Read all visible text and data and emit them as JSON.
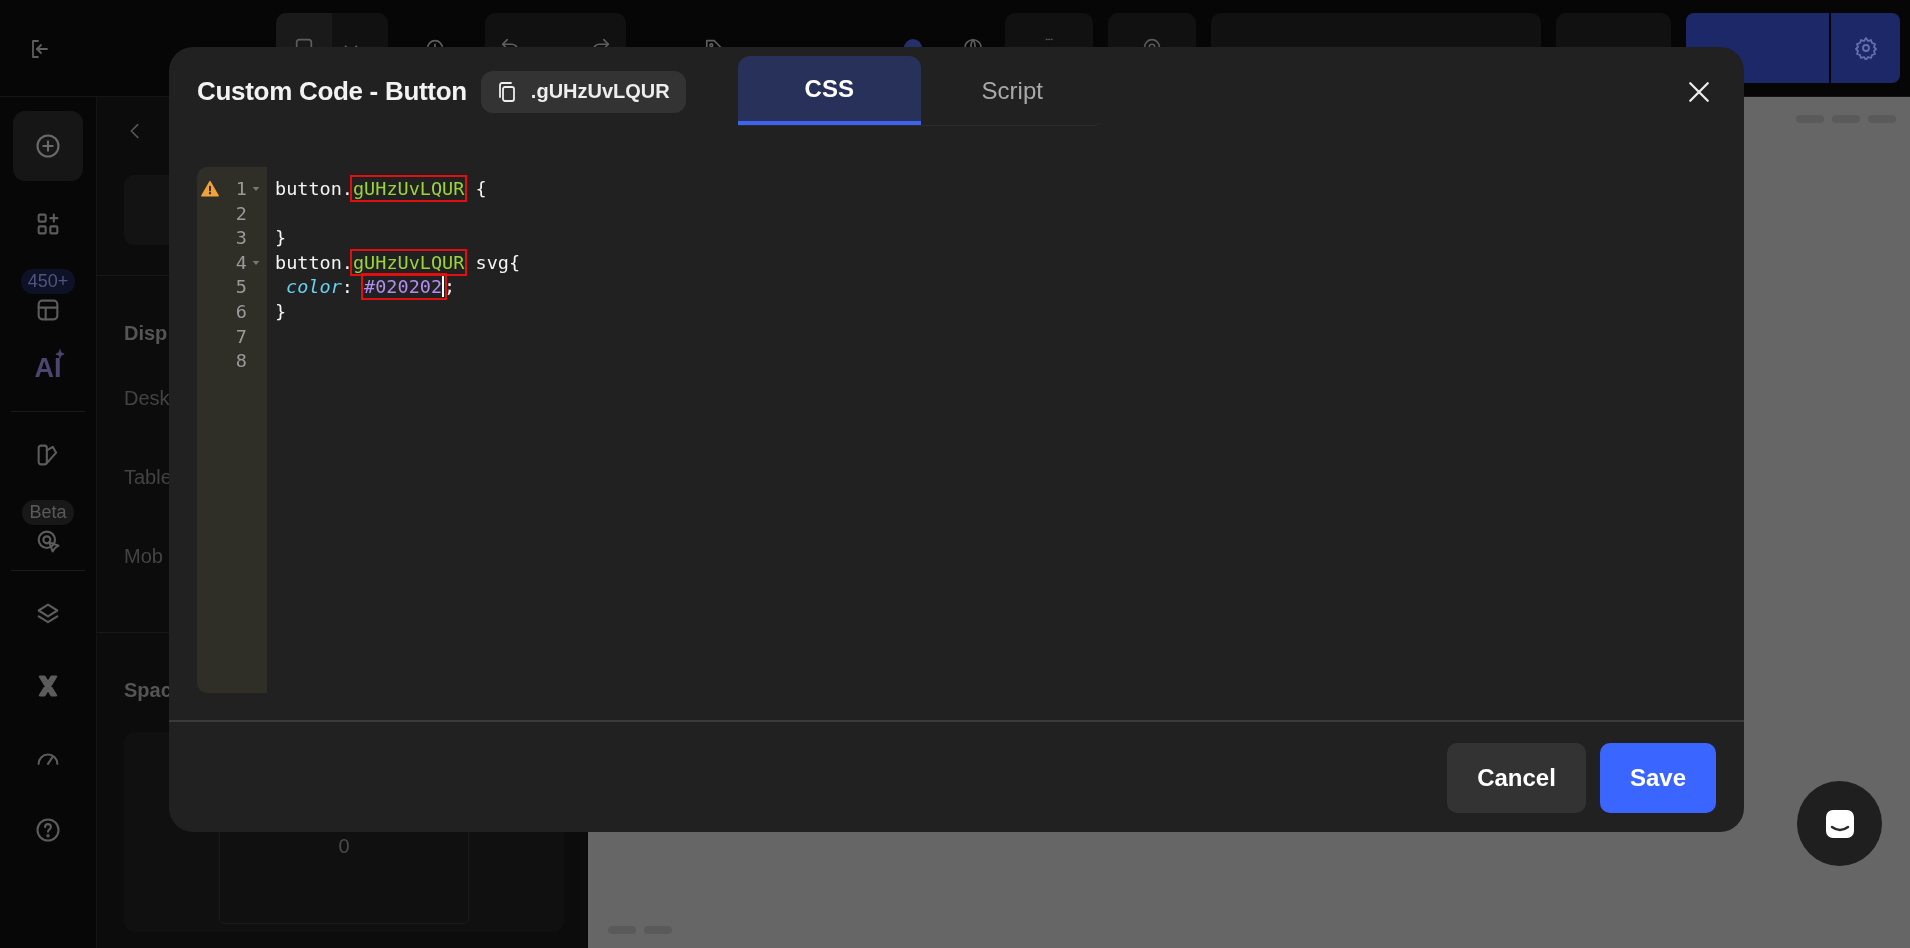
{
  "topbar": {
    "publish_highlighted": true
  },
  "rail": [
    {
      "kind": "add",
      "selected": true
    },
    {
      "kind": "elements"
    },
    {
      "kind": "templates",
      "badge": "450+"
    },
    {
      "kind": "ai",
      "label": "AI"
    },
    {
      "kind": "divider"
    },
    {
      "kind": "styles"
    },
    {
      "kind": "cursor",
      "badge": "Beta"
    },
    {
      "kind": "divider"
    },
    {
      "kind": "layers"
    },
    {
      "kind": "xmark"
    },
    {
      "kind": "speed"
    },
    {
      "kind": "help"
    }
  ],
  "panel": {
    "labels": [
      {
        "kind": "heading",
        "text": "Disp"
      },
      {
        "kind": "label",
        "text": "Desk"
      },
      {
        "kind": "label",
        "text": "Table"
      },
      {
        "kind": "label",
        "text": "Mob"
      },
      {
        "kind": "heading",
        "text": "Spac"
      }
    ],
    "spacing_value": "0"
  },
  "modal": {
    "title": "Custom Code - Button",
    "class_chip": ".gUHzUvLQUR",
    "tabs": [
      {
        "label": "CSS",
        "selected": true
      },
      {
        "label": "Script",
        "selected": false
      }
    ],
    "code": [
      {
        "number": "1",
        "warning": true,
        "fold": true,
        "tokens": [
          {
            "kind": "plain",
            "text": "button."
          },
          {
            "kind": "class",
            "text": "gUHzUvLQUR",
            "marked": true
          },
          {
            "kind": "plain",
            "text": " {"
          }
        ]
      },
      {
        "number": "2",
        "warning": false,
        "fold": false
      },
      {
        "number": "3",
        "warning": false,
        "fold": false,
        "tokens": [
          {
            "kind": "plain",
            "text": "}"
          }
        ]
      },
      {
        "number": "4",
        "warning": false,
        "fold": true,
        "tokens": [
          {
            "kind": "plain",
            "text": "button."
          },
          {
            "kind": "class",
            "text": "gUHzUvLQUR",
            "marked": true
          },
          {
            "kind": "plain",
            "text": " svg{"
          }
        ]
      },
      {
        "number": "5",
        "warning": false,
        "fold": false,
        "tokens": [
          {
            "kind": "property",
            "text": "color",
            "indent": true
          },
          {
            "kind": "plain",
            "text": ": "
          },
          {
            "kind": "value",
            "text": "#020202",
            "marked": true,
            "cursor": true
          },
          {
            "kind": "plain",
            "text": ";"
          }
        ]
      },
      {
        "number": "6",
        "warning": false,
        "fold": false,
        "tokens": [
          {
            "kind": "plain",
            "text": "}"
          }
        ]
      },
      {
        "number": "7",
        "warning": false,
        "fold": false
      },
      {
        "number": "8",
        "warning": false,
        "fold": false
      }
    ],
    "cancel": "Cancel",
    "save": "Save"
  }
}
